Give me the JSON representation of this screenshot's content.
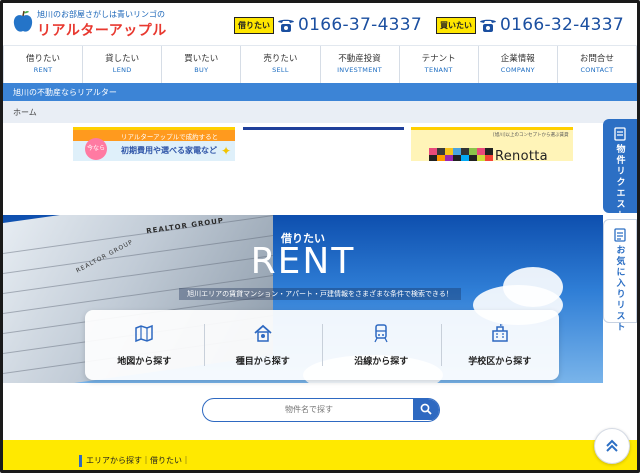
{
  "header": {
    "logo_tagline": "旭川のお部屋さがしは青いリンゴの",
    "logo_name": "リアルターアップル",
    "phones": [
      {
        "badge": "借りたい",
        "number": "0166-37-4337"
      },
      {
        "badge": "買いたい",
        "number": "0166-32-4337"
      }
    ]
  },
  "nav": {
    "items": [
      {
        "jp": "借りたい",
        "en": "RENT"
      },
      {
        "jp": "貸したい",
        "en": "LEND"
      },
      {
        "jp": "買いたい",
        "en": "BUY"
      },
      {
        "jp": "売りたい",
        "en": "SELL"
      },
      {
        "jp": "不動産投資",
        "en": "INVESTMENT"
      },
      {
        "jp": "テナント",
        "en": "TENANT"
      },
      {
        "jp": "企業情報",
        "en": "COMPANY"
      },
      {
        "jp": "お問合せ",
        "en": "CONTACT"
      }
    ]
  },
  "bluebar": {
    "text": "旭川の不動産ならリアルター"
  },
  "breadcrumb": {
    "home": "ホーム"
  },
  "banners": {
    "b1_top": "リアルターアップルで成約すると",
    "b1_circle": "今なら",
    "b1_text": "初期費用や選べる家電など",
    "b3_sub": "[旭川]以上のコンセプトから選ぶ賃貸",
    "b3_word": "Renotta"
  },
  "side_tabs": {
    "request": "物件リクエスト",
    "favorites": "お気に入りリスト"
  },
  "hero": {
    "sign1": "REALTOR GROUP",
    "sign2": "REALTOR GROUP",
    "subtitle": "借りたい",
    "title": "RENT",
    "description": "旭川エリアの賃貸マンション・アパート・戸建情報をさまざまな条件で検索できる！",
    "options": [
      {
        "label": "地図から探す",
        "icon": "map-icon"
      },
      {
        "label": "種目から探す",
        "icon": "house-icon"
      },
      {
        "label": "沿線から探す",
        "icon": "train-icon"
      },
      {
        "label": "学校区から探す",
        "icon": "school-icon"
      }
    ]
  },
  "keyword_search": {
    "placeholder": "物件名で探す",
    "icon": "search-icon"
  },
  "area": {
    "heading": "エリアから探す｜借りたい｜"
  },
  "colors": {
    "brand_blue": "#2c6fc4",
    "accent_yellow": "#ffe900",
    "logo_red": "#e8382f"
  }
}
